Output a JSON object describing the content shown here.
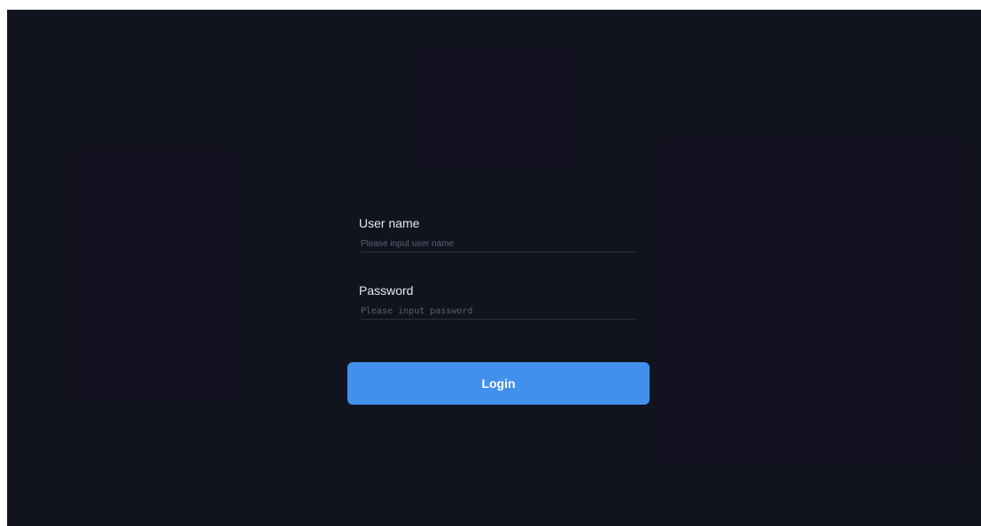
{
  "login_form": {
    "username_label": "User name",
    "username_placeholder": "Please input user name",
    "username_value": "",
    "password_label": "Password",
    "password_placeholder": "Please input password",
    "password_value": "",
    "login_label": "Login"
  },
  "colors": {
    "background": "#11141f",
    "accent": "#4190ee"
  }
}
